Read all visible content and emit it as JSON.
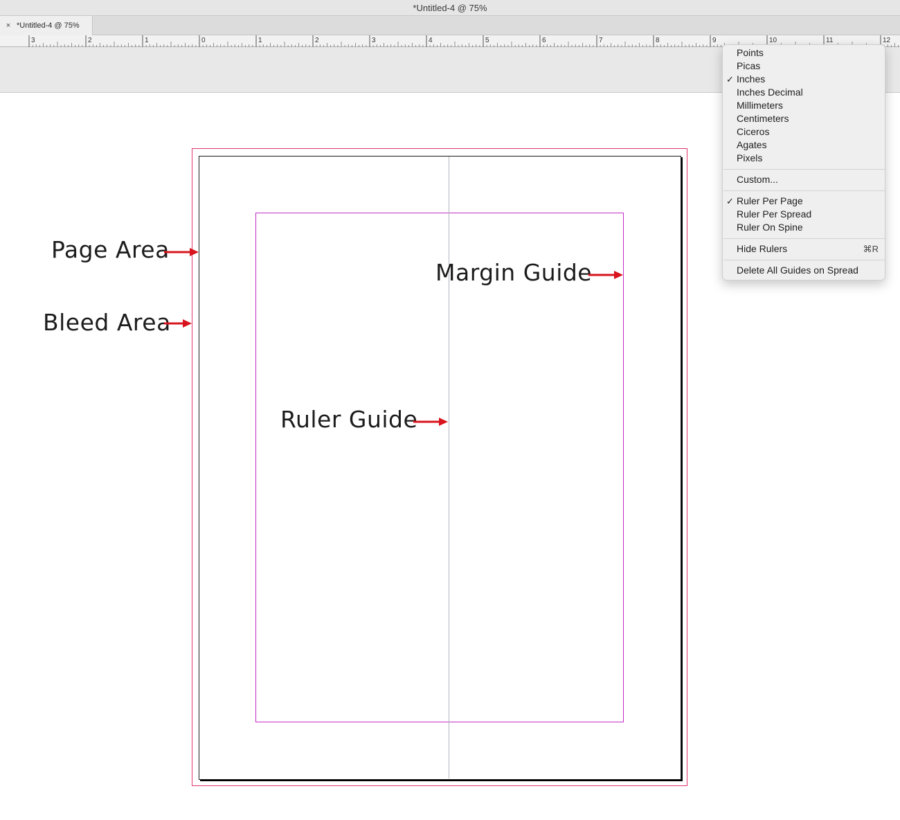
{
  "window": {
    "title": "*Untitled-4 @ 75%",
    "tab_label": "*Untitled-4 @ 75%",
    "tab_close": "×"
  },
  "ruler": {
    "unit": "inches",
    "labels": [
      "3",
      "2",
      "1",
      "0",
      "1",
      "2",
      "3",
      "4",
      "5",
      "6",
      "7",
      "8",
      "9",
      "10",
      "11",
      "12"
    ]
  },
  "annotations": {
    "page_area": "Page Area",
    "bleed_area": "Bleed Area",
    "margin_guide": "Margin Guide",
    "ruler_guide": "Ruler Guide"
  },
  "colors": {
    "bleed": "#e0356a",
    "margin": "#c42ac4",
    "ruler_guide": "#b0b4c0",
    "arrow": "#d8141e"
  },
  "context_menu": {
    "units": [
      {
        "label": "Points",
        "checked": false
      },
      {
        "label": "Picas",
        "checked": false
      },
      {
        "label": "Inches",
        "checked": true
      },
      {
        "label": "Inches Decimal",
        "checked": false
      },
      {
        "label": "Millimeters",
        "checked": false
      },
      {
        "label": "Centimeters",
        "checked": false
      },
      {
        "label": "Ciceros",
        "checked": false
      },
      {
        "label": "Agates",
        "checked": false
      },
      {
        "label": "Pixels",
        "checked": false
      }
    ],
    "custom": "Custom...",
    "ruler_modes": [
      {
        "label": "Ruler Per Page",
        "checked": true
      },
      {
        "label": "Ruler Per Spread",
        "checked": false
      },
      {
        "label": "Ruler On Spine",
        "checked": false
      }
    ],
    "hide_rulers": {
      "label": "Hide Rulers",
      "shortcut": "⌘R"
    },
    "delete_guides": "Delete All Guides on Spread",
    "check_glyph": "✓"
  }
}
